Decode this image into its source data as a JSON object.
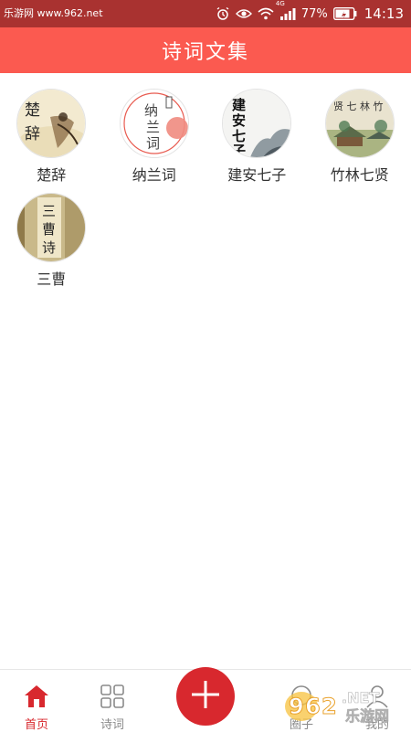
{
  "status": {
    "watermark": "乐游网 www.962.net",
    "battery": "77%",
    "time": "14:13",
    "network_tag": "4G"
  },
  "header": {
    "title": "诗词文集"
  },
  "collections": [
    {
      "label": "楚辞",
      "cover_text": "楚 辞"
    },
    {
      "label": "纳兰词",
      "cover_text": "纳兰词"
    },
    {
      "label": "建安七子",
      "cover_text": "建安七子"
    },
    {
      "label": "竹林七贤",
      "cover_text": "贤七林竹"
    },
    {
      "label": "三曹",
      "cover_text": "三曹诗"
    }
  ],
  "nav": {
    "home": "首页",
    "poems": "诗词",
    "circle": "圈子",
    "mine": "我的"
  },
  "watermark_logo": {
    "number": "962",
    "tld": ".NET",
    "cn": "乐游网"
  },
  "colors": {
    "status_bar": "#a93230",
    "header": "#fb5a50",
    "accent": "#d8282e",
    "inactive": "#8a8a8a"
  }
}
